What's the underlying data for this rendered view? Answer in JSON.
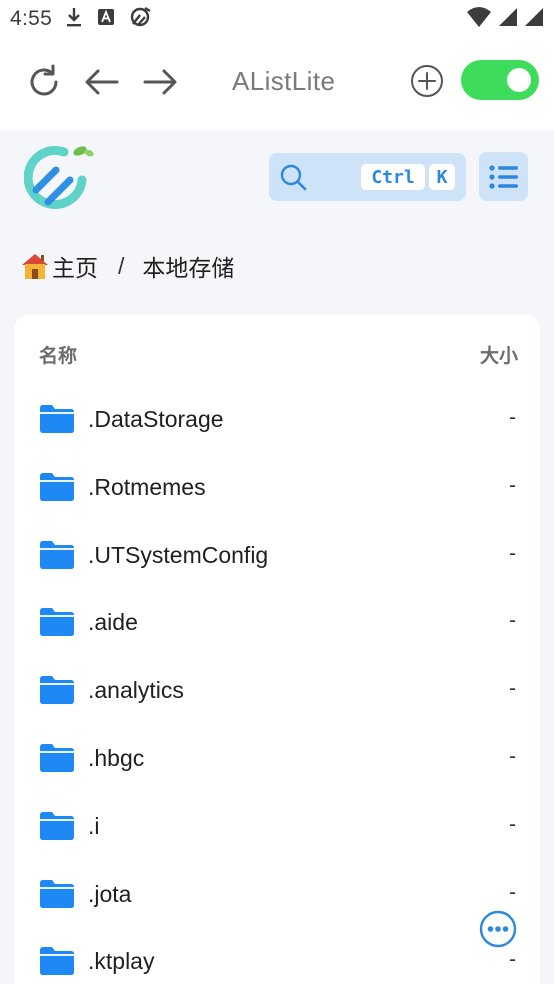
{
  "status_bar": {
    "time": "4:55",
    "icons": [
      "download-icon",
      "app-a-icon",
      "app-swirl-icon",
      "wifi-icon",
      "signal-icon",
      "signal-icon-2"
    ]
  },
  "app_bar": {
    "title": "AListLite",
    "toggle_on": true,
    "colors": {
      "toggle": "#3ddc5a",
      "icon": "#555555"
    }
  },
  "toolbar": {
    "search_ctrl": "Ctrl",
    "search_k": "K",
    "accent": "#2b87e0",
    "search_bg": "#cfe3f8"
  },
  "breadcrumb": {
    "home_label": "主页",
    "separator": "/",
    "current": "本地存储"
  },
  "list": {
    "header": {
      "name": "名称",
      "size": "大小"
    },
    "items": [
      {
        "name": ".DataStorage",
        "size": "-"
      },
      {
        "name": ".Rotmemes",
        "size": "-"
      },
      {
        "name": ".UTSystemConfig",
        "size": "-"
      },
      {
        "name": ".aide",
        "size": "-"
      },
      {
        "name": ".analytics",
        "size": "-"
      },
      {
        "name": ".hbgc",
        "size": "-"
      },
      {
        "name": ".i",
        "size": "-"
      },
      {
        "name": ".jota",
        "size": "-"
      },
      {
        "name": ".ktplay",
        "size": "-"
      }
    ],
    "folder_color": "#1e88f5"
  }
}
